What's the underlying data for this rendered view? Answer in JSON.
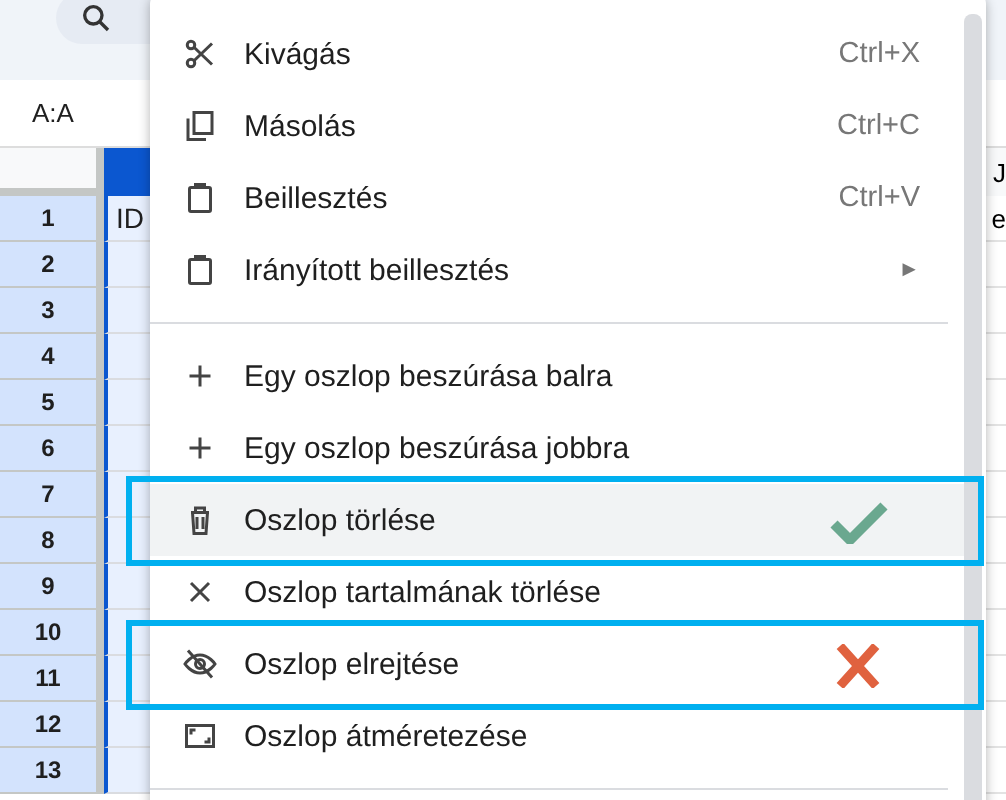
{
  "name_box": "A:A",
  "sheet": {
    "column_a_selected": true,
    "right_header": "J",
    "rows": [
      {
        "number": "1",
        "cell_a": "ID",
        "cell_right": "e"
      },
      {
        "number": "2"
      },
      {
        "number": "3"
      },
      {
        "number": "4"
      },
      {
        "number": "5"
      },
      {
        "number": "6"
      },
      {
        "number": "7"
      },
      {
        "number": "8"
      },
      {
        "number": "9"
      },
      {
        "number": "10"
      },
      {
        "number": "11"
      },
      {
        "number": "12"
      },
      {
        "number": "13"
      }
    ]
  },
  "menu": {
    "items": [
      {
        "kind": "scissors",
        "label": "Kivágás",
        "shortcut": "Ctrl+X",
        "highlighted": false
      },
      {
        "kind": "copy",
        "label": "Másolás",
        "shortcut": "Ctrl+C",
        "highlighted": false
      },
      {
        "kind": "clipboard",
        "label": "Beillesztés",
        "shortcut": "Ctrl+V",
        "highlighted": false
      },
      {
        "kind": "clipboard",
        "label": "Irányított beillesztés",
        "submenu": "►",
        "highlighted": false
      },
      {
        "kind": "divider"
      },
      {
        "kind": "plus",
        "label": "Egy oszlop beszúrása balra",
        "highlighted": false
      },
      {
        "kind": "plus",
        "label": "Egy oszlop beszúrása jobbra",
        "highlighted": false
      },
      {
        "kind": "trash",
        "label": "Oszlop törlése",
        "highlighted": true,
        "annotation": {
          "kind": "check"
        }
      },
      {
        "kind": "clear",
        "label": "Oszlop tartalmának törlése",
        "highlighted": false
      },
      {
        "kind": "hide",
        "label": "Oszlop elrejtése",
        "highlighted": false,
        "annotation": {
          "kind": "cross"
        }
      },
      {
        "kind": "resize",
        "label": "Oszlop átméretezése",
        "highlighted": false
      },
      {
        "kind": "divider"
      }
    ]
  }
}
